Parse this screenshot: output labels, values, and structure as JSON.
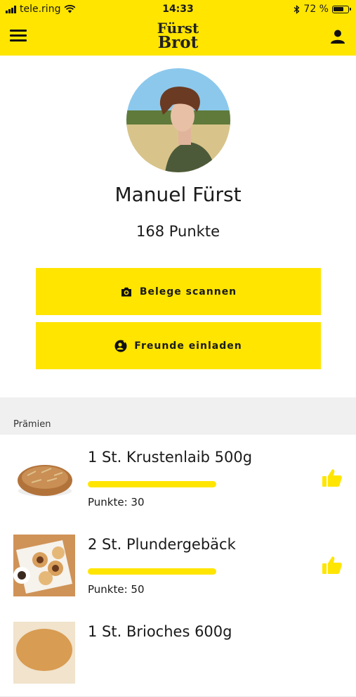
{
  "status": {
    "carrier": "tele.ring",
    "time": "14:33",
    "battery": "72 %",
    "battery_level": 0.72
  },
  "header": {
    "logo_line1": "Fürst",
    "logo_line2": "Brot"
  },
  "profile": {
    "name": "Manuel Fürst",
    "points": "168 Punkte"
  },
  "actions": {
    "scan_label": "Belege scannen",
    "invite_label": "Freunde einladen"
  },
  "rewards": {
    "section_title": "Prämien",
    "items": [
      {
        "title": "1 St. Krustenlaib 500g",
        "points": "Punkte: 30",
        "progress": 1.0
      },
      {
        "title": "2 St. Plundergebäck",
        "points": "Punkte: 50",
        "progress": 1.0
      },
      {
        "title": "1 St. Brioches 600g"
      }
    ]
  },
  "colors": {
    "accent": "#ffe500"
  },
  "icons": {
    "menu": "hamburger-icon",
    "user": "user-icon",
    "camera": "camera-icon",
    "invite": "add-friend-icon",
    "like": "thumbs-up-icon"
  }
}
